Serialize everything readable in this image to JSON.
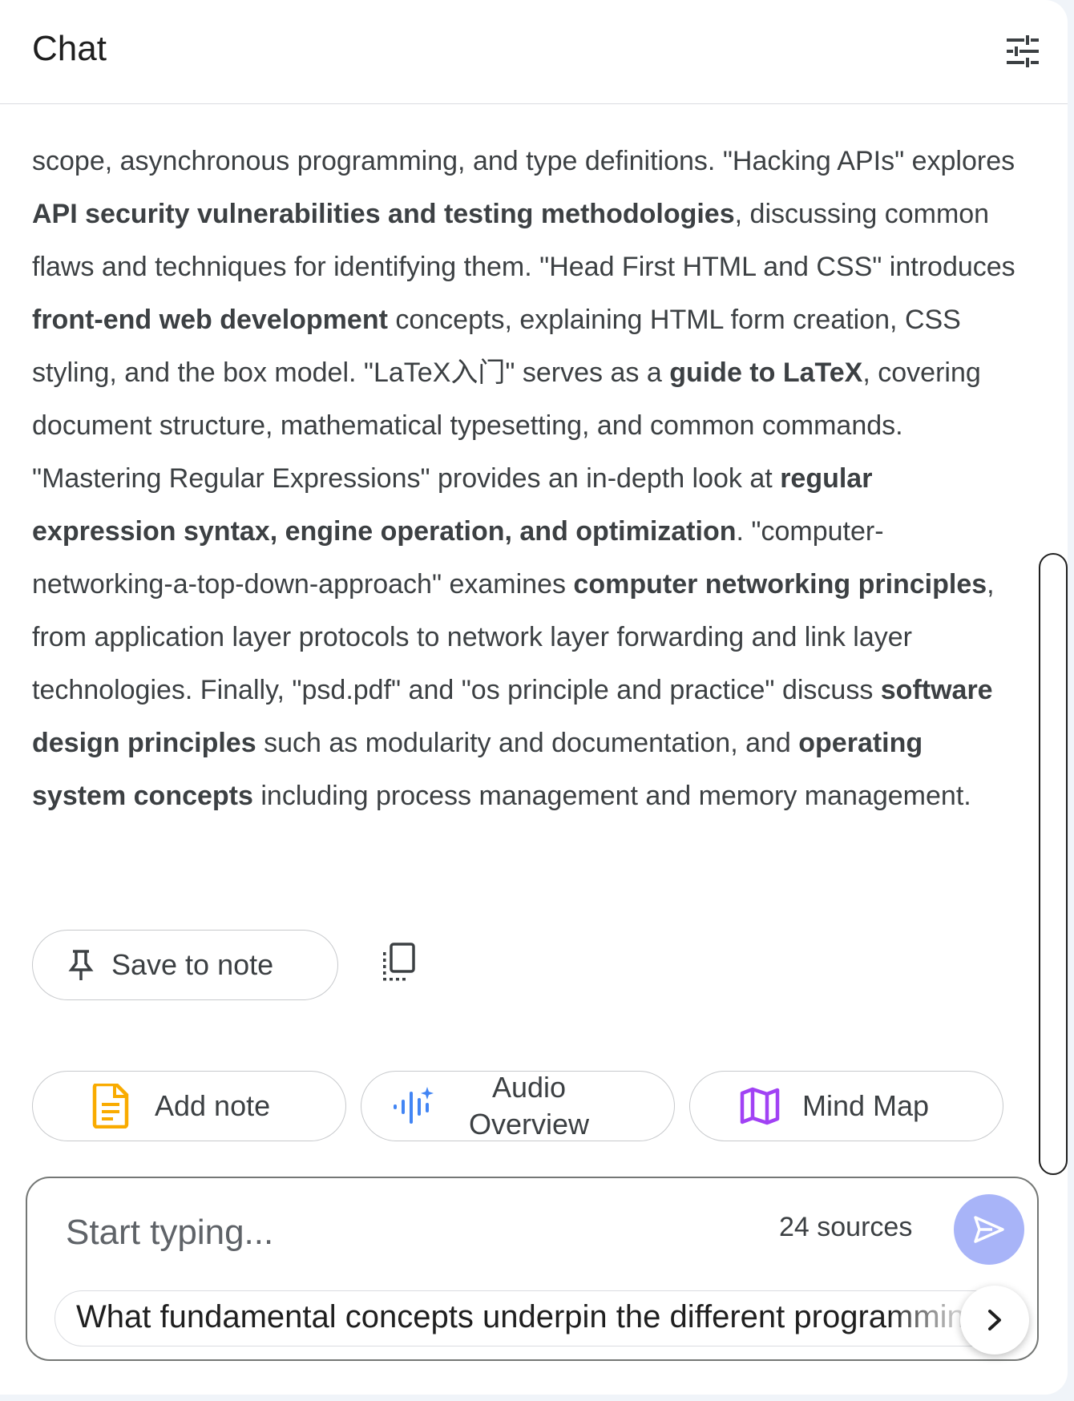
{
  "header": {
    "title": "Chat",
    "settings_icon": "tune-icon"
  },
  "content": {
    "segments": [
      {
        "t": "scope, asynchronous programming, and type definitions. \"Hacking APIs\" explores ",
        "b": false
      },
      {
        "t": "API security vulnerabilities and testing methodologies",
        "b": true
      },
      {
        "t": ", discussing common flaws and techniques for identifying them. \"Head First HTML and CSS\" introduces ",
        "b": false
      },
      {
        "t": "front-end web development",
        "b": true
      },
      {
        "t": " concepts, explaining HTML form creation, CSS styling, and the box model. \"LaTeX入门\" serves as a ",
        "b": false
      },
      {
        "t": "guide to LaTeX",
        "b": true
      },
      {
        "t": ", covering document structure, mathematical typesetting, and common commands. \"Mastering Regular Expressions\" provides an in-depth look at ",
        "b": false
      },
      {
        "t": "regular expression syntax, engine operation, and optimization",
        "b": true
      },
      {
        "t": ". \"computer-networking-a-top-down-approach\" examines ",
        "b": false
      },
      {
        "t": "computer networking principles",
        "b": true
      },
      {
        "t": ", from application layer protocols to network layer forwarding and link layer technologies. Finally, \"psd.pdf\" and \"os principle and practice\" discuss ",
        "b": false
      },
      {
        "t": "software design principles",
        "b": true
      },
      {
        "t": " such as modularity and documentation, and ",
        "b": false
      },
      {
        "t": "operating system concepts",
        "b": true
      },
      {
        "t": " including process management and memory management.",
        "b": false
      }
    ]
  },
  "actions": {
    "save_label": "Save to note",
    "save_icon": "pin-icon",
    "copy_icon": "copy-icon"
  },
  "chips": {
    "add_note": "Add note",
    "audio_line1": "Audio",
    "audio_line2": "Overview",
    "mind_map": "Mind Map",
    "colors": {
      "add_note": "#f9ab00",
      "audio": "#4285f4",
      "mind_map": "#a142f4"
    }
  },
  "input": {
    "placeholder": "Start typing...",
    "sources": "24 sources",
    "send_color": "#a8b4f8",
    "suggestion": "What fundamental concepts underpin the different programming"
  }
}
